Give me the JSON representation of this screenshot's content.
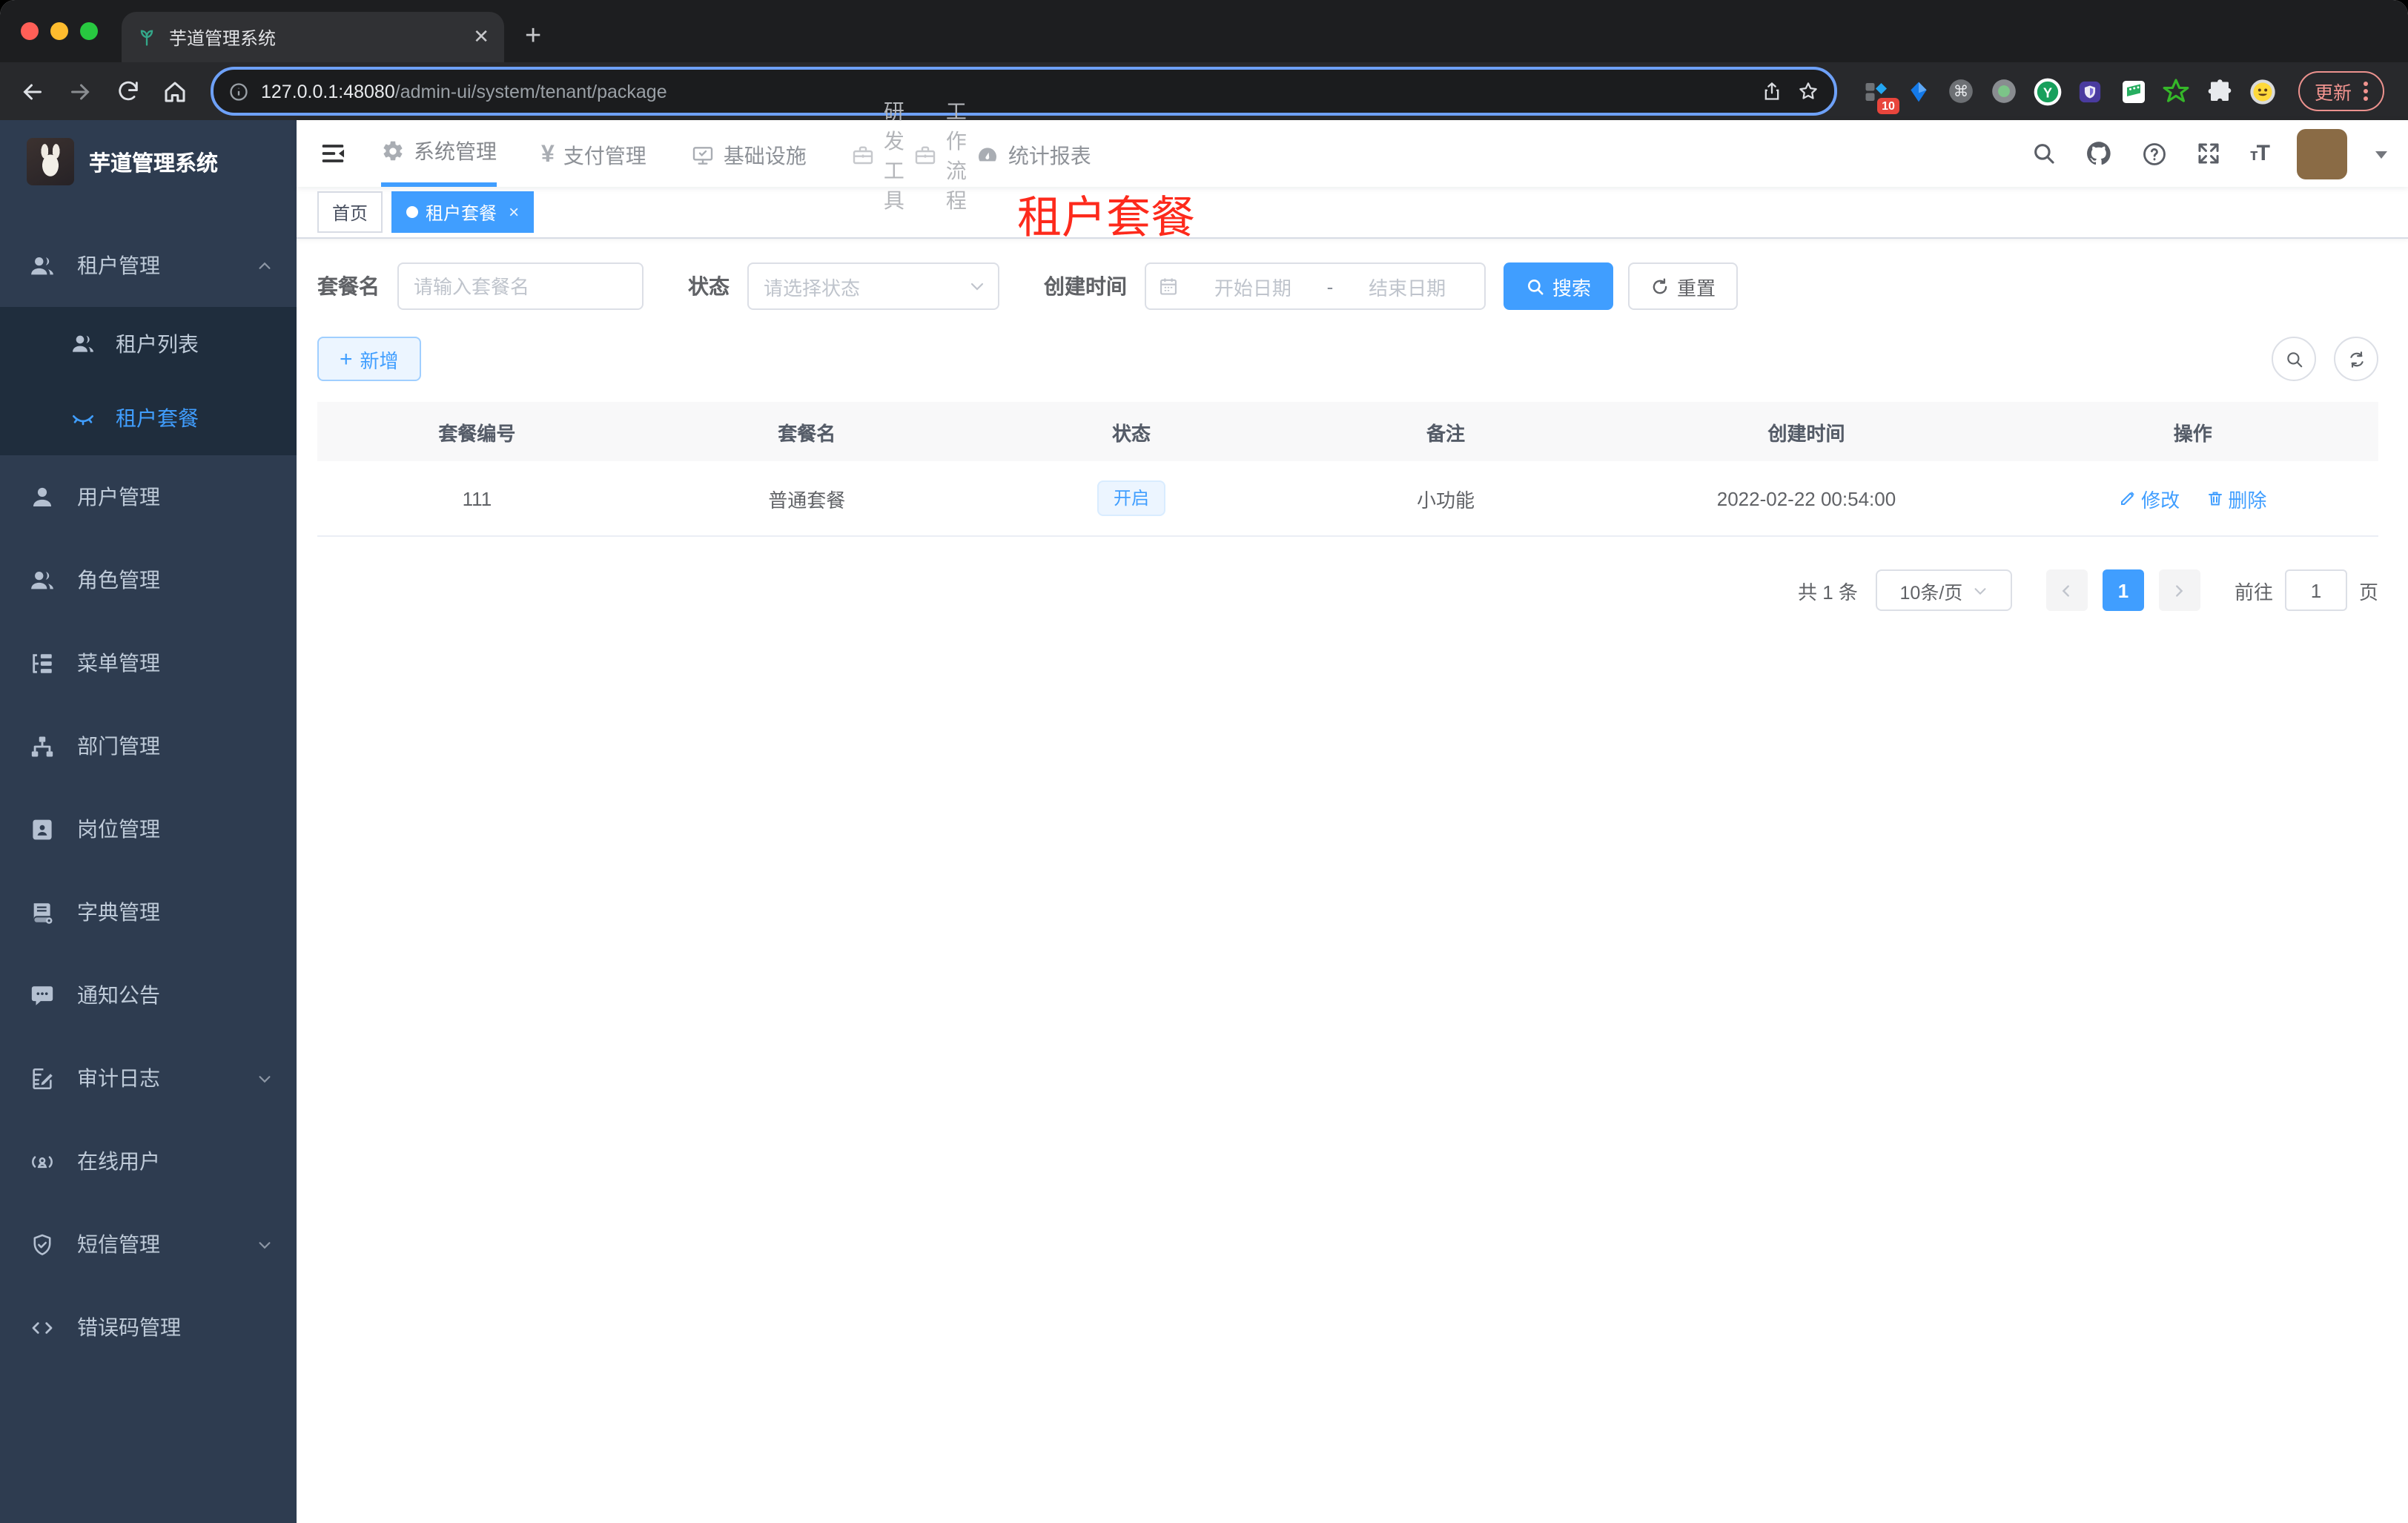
{
  "browser": {
    "tab_title": "芋道管理系统",
    "address": {
      "host": "127.0.0.1:48080",
      "path": "/admin-ui/system/tenant/package"
    },
    "extensions_badge": "10",
    "update_label": "更新"
  },
  "sidebar": {
    "logo_title": "芋道管理系统",
    "items": {
      "tenant": "租户管理",
      "tenant_list": "租户列表",
      "tenant_package": "租户套餐",
      "user": "用户管理",
      "role": "角色管理",
      "menu": "菜单管理",
      "dept": "部门管理",
      "post": "岗位管理",
      "dict": "字典管理",
      "notice": "通知公告",
      "audit": "审计日志",
      "online": "在线用户",
      "sms": "短信管理",
      "errcode": "错误码管理"
    }
  },
  "topnav": {
    "system": "系统管理",
    "pay": "支付管理",
    "infra": "基础设施",
    "dev": "研发工具",
    "workflow": "工作流程",
    "report": "统计报表",
    "yen": "¥"
  },
  "tags": {
    "home": "首页",
    "active": "租户套餐",
    "close": "×"
  },
  "annotation": {
    "text": "租户套餐",
    "color": "#fd2a1c"
  },
  "filter": {
    "name_label": "套餐名",
    "name_placeholder": "请输入套餐名",
    "status_label": "状态",
    "status_placeholder": "请选择状态",
    "date_label": "创建时间",
    "date_start_placeholder": "开始日期",
    "date_separator": "-",
    "date_end_placeholder": "结束日期",
    "search_label": "搜索",
    "reset_label": "重置"
  },
  "toolbar": {
    "add_label": "新增"
  },
  "table": {
    "columns": [
      "套餐编号",
      "套餐名",
      "状态",
      "备注",
      "创建时间",
      "操作"
    ],
    "row": {
      "id": "111",
      "name": "普通套餐",
      "status": "开启",
      "remark": "小功能",
      "created": "2022-02-22 00:54:00",
      "edit": "修改",
      "delete": "删除"
    }
  },
  "pagination": {
    "total": "共 1 条",
    "page_size": "10条/页",
    "current_page": "1",
    "goto_label": "前往",
    "goto_value": "1",
    "page_unit": "页"
  },
  "colors": {
    "primary": "#409eff",
    "annotation_red": "#fd2a1c",
    "sidebar_bg": "#2e3c50",
    "submenu_bg": "#1f2d3d",
    "tag_active_bg": "#409eff"
  }
}
